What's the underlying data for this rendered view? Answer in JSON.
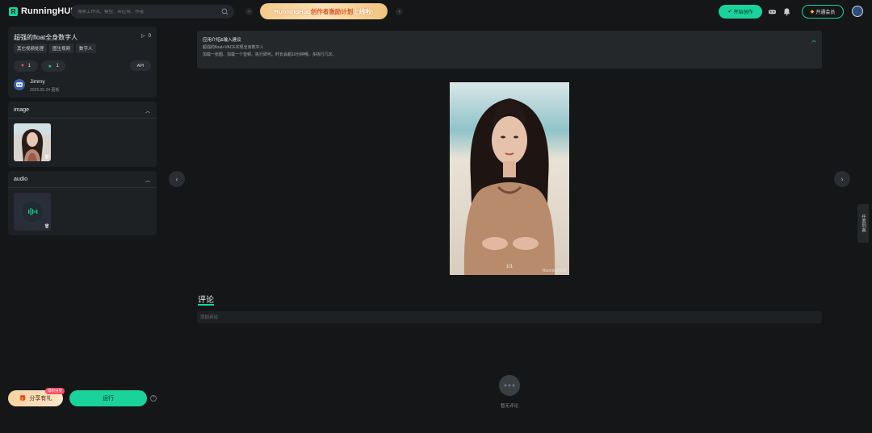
{
  "header": {
    "logo_text": "RunningHUB",
    "search_placeholder": "搜索工作流、模型、AI应用、作者",
    "banner_prefix": "RunningHub",
    "banner_highlight": "创作者激励计划",
    "banner_suffix": "上线啦!",
    "create_button": "开始创作",
    "member_button": "开通会员",
    "icons": [
      "game-controller-icon",
      "bell-icon",
      "user-avatar"
    ],
    "accent_color": "#19d39a"
  },
  "app": {
    "title": "超强的float全身数字人",
    "play_count": "0",
    "tags": [
      "其它视频处理",
      "图生视频",
      "数字人"
    ],
    "likes": "1",
    "favorites": "1",
    "api_label": "API",
    "author_name": "Jimmy",
    "author_date": "2025.05.24 更新"
  },
  "inputs": {
    "image_label": "image",
    "audio_label": "audio"
  },
  "actions": {
    "share_label": "分享有礼",
    "share_badge": "得积分奖",
    "run_label": "运行",
    "help_label": "?"
  },
  "intro": {
    "title": "应用介绍&输入建议",
    "line1": "超强的float+VACE实现全身数字人",
    "line2": "加载一张图、加载一个音频、执行即可。时长会超10分钟哦，多执行几次。"
  },
  "preview": {
    "counter": "1/1",
    "watermark": "RunningHUB"
  },
  "side_tab": "任务列表",
  "comments": {
    "title": "评论",
    "placeholder": "添加评论",
    "empty_text": "暂无评论"
  }
}
